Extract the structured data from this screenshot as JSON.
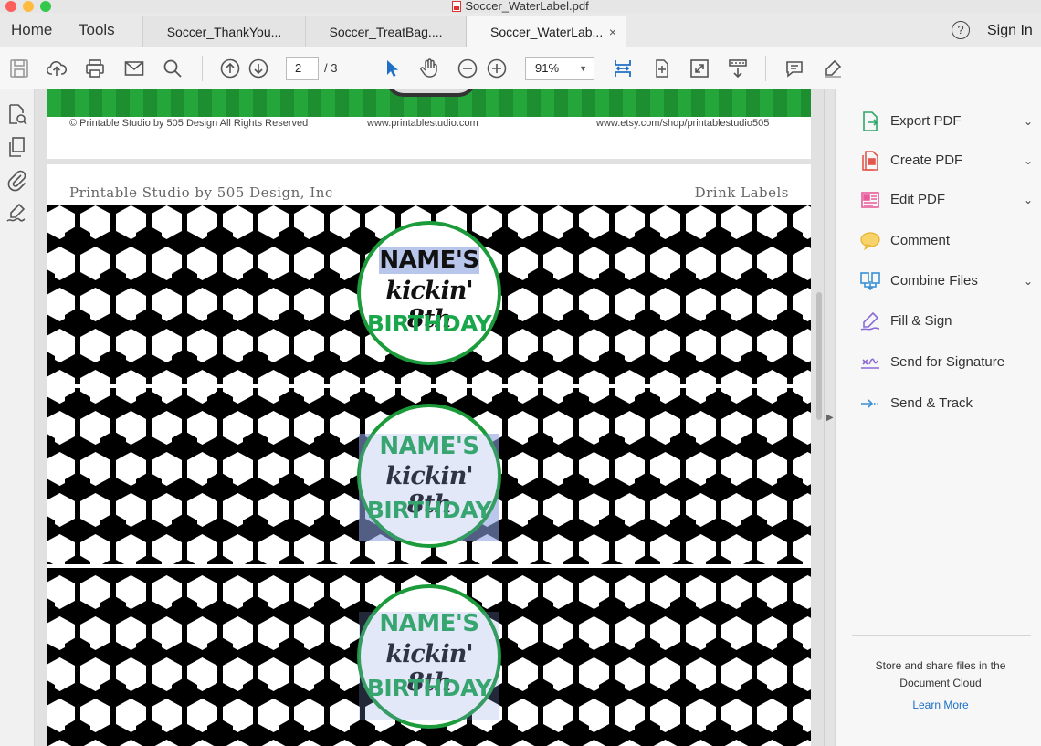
{
  "window": {
    "title": "Soccer_WaterLabel.pdf"
  },
  "nav": {
    "home": "Home",
    "tools": "Tools"
  },
  "tabs": [
    {
      "label": "Soccer_ThankYou..."
    },
    {
      "label": "Soccer_TreatBag...."
    },
    {
      "label": "Soccer_WaterLab..."
    }
  ],
  "tab_close": "×",
  "help": "?",
  "sign_in": "Sign In",
  "toolbar": {
    "page_current": "2",
    "page_total": "/ 3",
    "zoom": "91%",
    "zoom_caret": "▼"
  },
  "document": {
    "page1_footer": {
      "copyright": "© Printable Studio by 505 Design All Rights Reserved",
      "website": "www.printablestudio.com",
      "etsy": "www.etsy.com/shop/printablestudio505"
    },
    "page2_header": {
      "left": "Printable Studio by 505 Design, Inc",
      "right": "Drink Labels"
    },
    "labels": [
      {
        "line1": "NAME'S",
        "line2": "kickin' 8th",
        "line3": "BIRTHDAY"
      },
      {
        "line1": "NAME'S",
        "line2": "kickin' 8th",
        "line3": "BIRTHDAY"
      },
      {
        "line1": "NAME'S",
        "line2": "kickin' 8th",
        "line3": "BIRTHDAY"
      }
    ]
  },
  "right_panel": {
    "items": [
      {
        "label": "Export PDF",
        "chevron": "⌄",
        "color": "#2fa66a"
      },
      {
        "label": "Create PDF",
        "chevron": "⌄",
        "color": "#e2574c"
      },
      {
        "label": "Edit PDF",
        "chevron": "⌄",
        "color": "#e85a9b"
      },
      {
        "label": "Comment",
        "chevron": "",
        "color": "#f3c13a"
      },
      {
        "label": "Combine Files",
        "chevron": "⌄",
        "color": "#3a8fd6"
      },
      {
        "label": "Fill & Sign",
        "chevron": "",
        "color": "#8a6bd8"
      },
      {
        "label": "Send for Signature",
        "chevron": "",
        "color": "#8a6bd8"
      },
      {
        "label": "Send & Track",
        "chevron": "",
        "color": "#3a8fd6"
      }
    ],
    "cloud_text": "Store and share files in the Document Cloud",
    "learn_more": "Learn More"
  },
  "colors": {
    "accent_blue": "#1f6fc5",
    "soccer_green": "#1aa64a",
    "stripe_green": "#25a63a"
  }
}
